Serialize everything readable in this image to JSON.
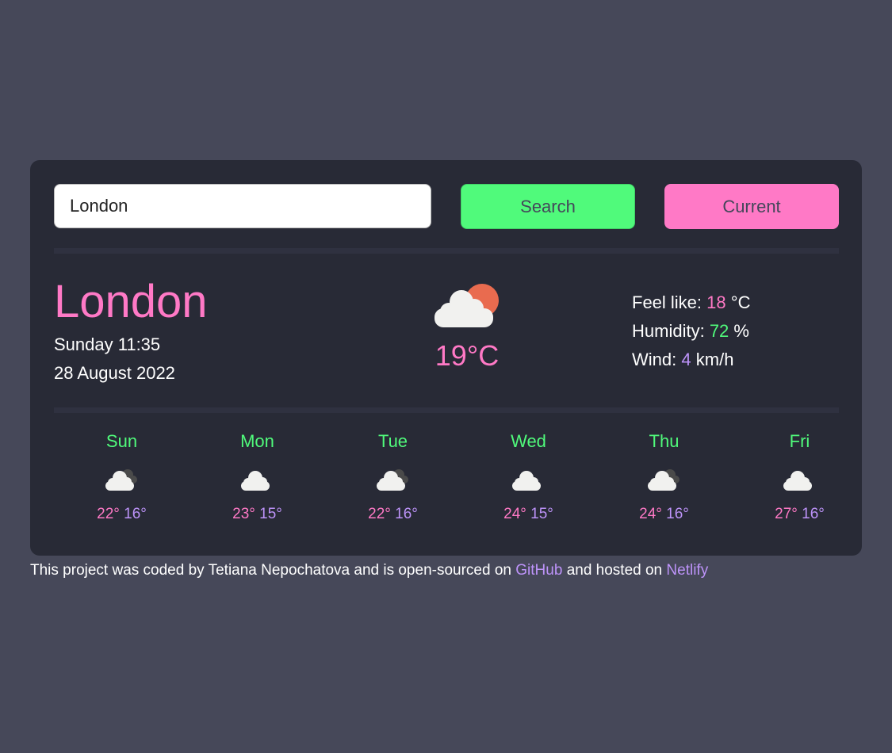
{
  "colors": {
    "background": "#464859",
    "card": "#282a36",
    "pink": "#ff79c6",
    "green": "#50fa7b",
    "purple": "#bd93f9"
  },
  "search": {
    "value": "London",
    "search_label": "Search",
    "current_label": "Current"
  },
  "current": {
    "city": "London",
    "day_time": "Sunday 11:35",
    "date": "28 August 2022",
    "temperature": "19°C",
    "icon": "partly-cloudy-day-icon",
    "feels_label": "Feel like:",
    "feels_value": "18",
    "feels_unit": "°C",
    "humidity_label": "Humidity:",
    "humidity_value": "72",
    "humidity_unit": "%",
    "wind_label": "Wind:",
    "wind_value": "4",
    "wind_unit": "km/h"
  },
  "forecast": [
    {
      "day": "Sun",
      "max": "22°",
      "min": "16°",
      "icon": "broken-clouds-icon"
    },
    {
      "day": "Mon",
      "max": "23°",
      "min": "15°",
      "icon": "cloud-icon"
    },
    {
      "day": "Tue",
      "max": "22°",
      "min": "16°",
      "icon": "broken-clouds-icon"
    },
    {
      "day": "Wed",
      "max": "24°",
      "min": "15°",
      "icon": "cloud-icon"
    },
    {
      "day": "Thu",
      "max": "24°",
      "min": "16°",
      "icon": "broken-clouds-icon"
    },
    {
      "day": "Fri",
      "max": "27°",
      "min": "16°",
      "icon": "cloud-icon"
    }
  ],
  "footer": {
    "text_1": "This project was coded by Tetiana Nepochatova and is open-sourced on",
    "github": "GitHub",
    "text_2": "and hosted on",
    "netlify": "Netlify"
  }
}
